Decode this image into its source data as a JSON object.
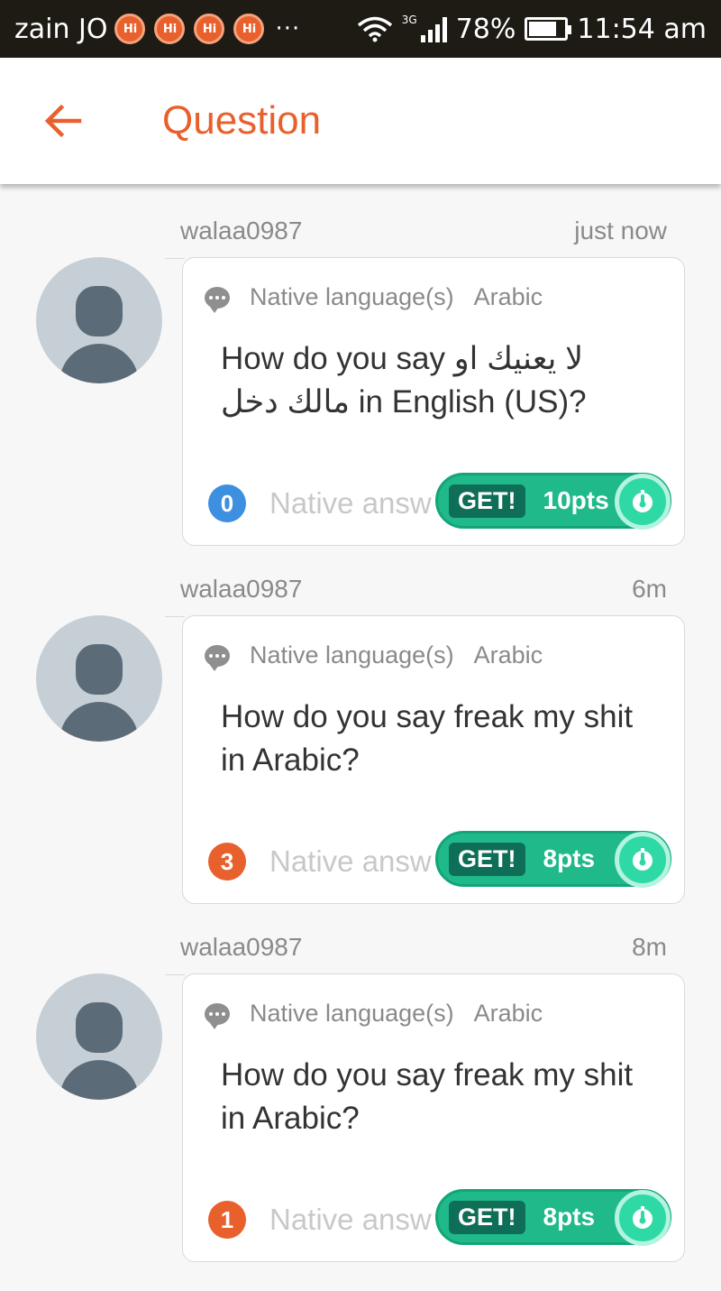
{
  "status_bar": {
    "carrier": "zain JO",
    "notifications": [
      "Hi",
      "Hi",
      "Hi",
      "Hi"
    ],
    "more": "···",
    "network": "3G",
    "battery": "78%",
    "battery_level": 0.78,
    "time": "11:54 am"
  },
  "header": {
    "title": "Question"
  },
  "questions": [
    {
      "user": "walaa0987",
      "time": "just now",
      "lang_label": "Native language(s)",
      "lang_value": "Arabic",
      "text": "How do you say لا يعنيك او مالك دخل  in English (US)?",
      "answer_count": "0",
      "answer_label": "Native answ",
      "get_label": "GET!",
      "points": "10pts"
    },
    {
      "user": "walaa0987",
      "time": "6m",
      "lang_label": "Native language(s)",
      "lang_value": "Arabic",
      "text": "How do you say freak my shit  in Arabic?",
      "answer_count": "3",
      "answer_label": "Native answ",
      "get_label": "GET!",
      "points": "8pts"
    },
    {
      "user": "walaa0987",
      "time": "8m",
      "lang_label": "Native language(s)",
      "lang_value": "Arabic",
      "text": "How do you say freak my shit in Arabic?",
      "answer_count": "1",
      "answer_label": "Native answ",
      "get_label": "GET!",
      "points": "8pts"
    }
  ],
  "colors": {
    "accent": "#e8602c",
    "zero_badge": "#3d8fe0",
    "count_badge": "#e8602c",
    "get_green": "#1fb98a"
  }
}
